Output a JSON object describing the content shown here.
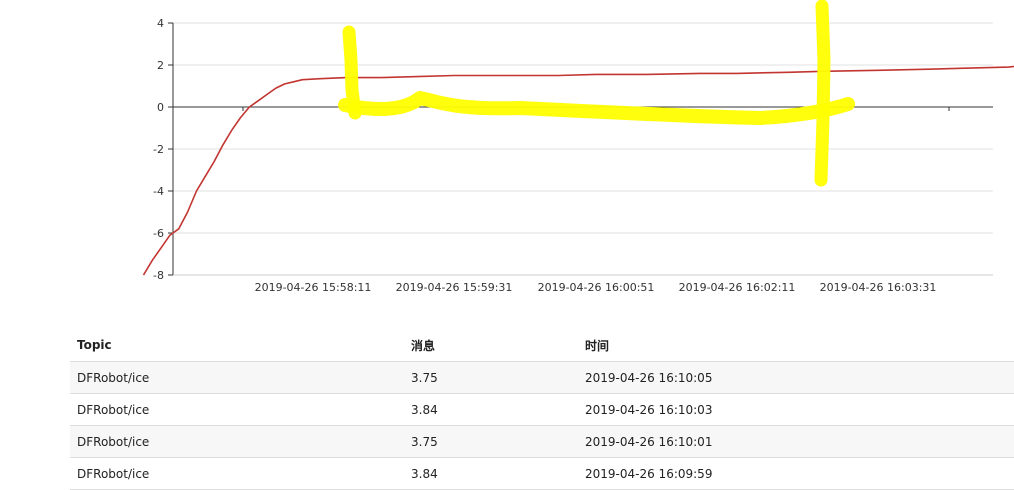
{
  "chart_data": {
    "type": "line",
    "title": "",
    "xlabel": "",
    "ylabel": "",
    "ylim": [
      -8,
      4
    ],
    "yticks": [
      4,
      2,
      0,
      -2,
      -4,
      -6,
      -8
    ],
    "xtick_labels": [
      "2019-04-26 15:58:11",
      "2019-04-26 15:59:31",
      "2019-04-26 16:00:51",
      "2019-04-26 16:02:11",
      "2019-04-26 16:03:31"
    ],
    "grid": true,
    "legend": "none",
    "colors": {
      "series": "#c23531",
      "axis": "#333333",
      "grid": "#e0e0e0",
      "highlight": "#ffff00"
    },
    "series": [
      {
        "points": [
          [
            "15:56:35",
            -8.0
          ],
          [
            "15:56:40",
            -7.3
          ],
          [
            "15:56:45",
            -6.7
          ],
          [
            "15:56:50",
            -6.1
          ],
          [
            "15:56:55",
            -5.8
          ],
          [
            "15:57:00",
            -5.0
          ],
          [
            "15:57:05",
            -4.0
          ],
          [
            "15:57:10",
            -3.3
          ],
          [
            "15:57:15",
            -2.6
          ],
          [
            "15:57:20",
            -1.8
          ],
          [
            "15:57:25",
            -1.1
          ],
          [
            "15:57:30",
            -0.5
          ],
          [
            "15:57:35",
            0.0
          ],
          [
            "15:57:40",
            0.3
          ],
          [
            "15:57:45",
            0.6
          ],
          [
            "15:57:50",
            0.9
          ],
          [
            "15:57:55",
            1.1
          ],
          [
            "15:58:00",
            1.2
          ],
          [
            "15:58:05",
            1.3
          ],
          [
            "15:58:15",
            1.35
          ],
          [
            "15:58:30",
            1.4
          ],
          [
            "15:58:50",
            1.4
          ],
          [
            "15:59:10",
            1.45
          ],
          [
            "15:59:31",
            1.5
          ],
          [
            "16:00:00",
            1.5
          ],
          [
            "16:00:30",
            1.5
          ],
          [
            "16:00:51",
            1.55
          ],
          [
            "16:01:20",
            1.55
          ],
          [
            "16:01:50",
            1.6
          ],
          [
            "16:02:11",
            1.6
          ],
          [
            "16:02:40",
            1.65
          ],
          [
            "16:03:00",
            1.7
          ],
          [
            "16:03:31",
            1.75
          ],
          [
            "16:04:00",
            1.8
          ],
          [
            "16:04:20",
            1.85
          ],
          [
            "16:04:45",
            1.9
          ],
          [
            "16:05:00",
            2.05
          ],
          [
            "16:05:10",
            2.0
          ]
        ]
      }
    ]
  },
  "annotations": {
    "description": "Yellow hand-drawn highlighter strokes over the chart"
  },
  "table": {
    "headers": [
      "Topic",
      "消息",
      "时间"
    ],
    "rows": [
      [
        "DFRobot/ice",
        "3.75",
        "2019-04-26 16:10:05"
      ],
      [
        "DFRobot/ice",
        "3.84",
        "2019-04-26 16:10:03"
      ],
      [
        "DFRobot/ice",
        "3.75",
        "2019-04-26 16:10:01"
      ],
      [
        "DFRobot/ice",
        "3.84",
        "2019-04-26 16:09:59"
      ]
    ]
  }
}
